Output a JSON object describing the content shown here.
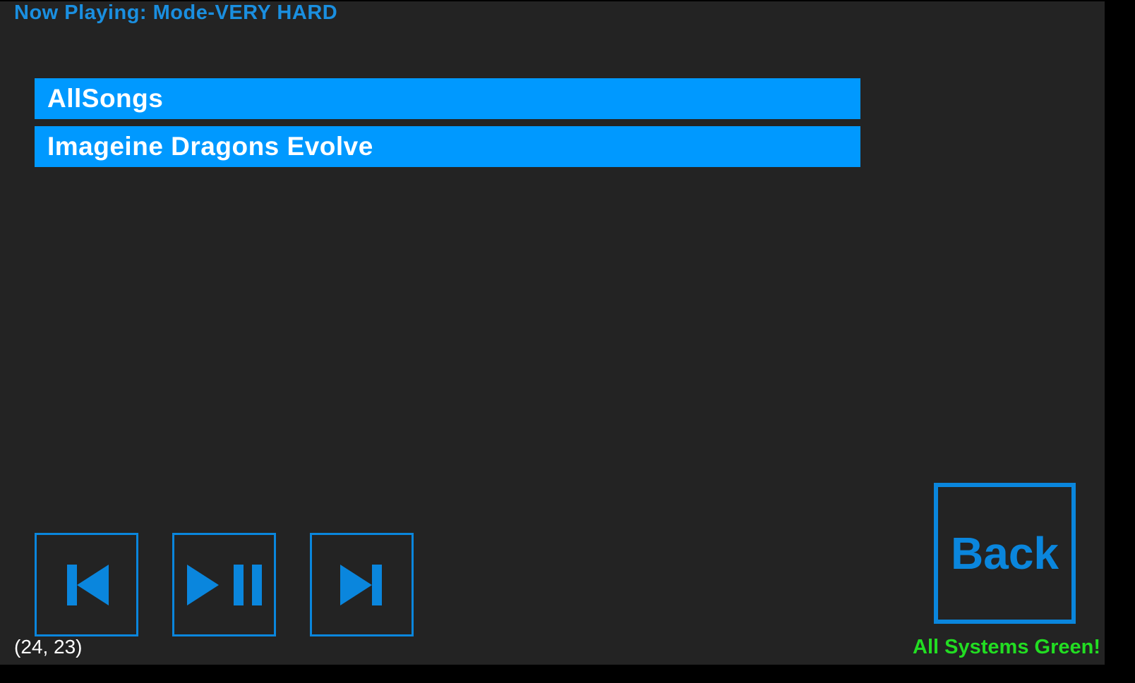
{
  "header": {
    "now_playing": "Now Playing: Mode-VERY HARD"
  },
  "playlist": {
    "items": [
      {
        "label": "AllSongs"
      },
      {
        "label": "Imageine Dragons Evolve"
      }
    ]
  },
  "controls": {
    "previous_icon": "skip-previous-icon",
    "play_pause_icon": "play-pause-icon",
    "next_icon": "skip-next-icon"
  },
  "back_button": {
    "label": "Back"
  },
  "footer": {
    "cursor_readout": "(24, 23)",
    "status": "All Systems Green!"
  },
  "colors": {
    "background": "#232323",
    "accent": "#0099ff",
    "icon_blue": "#0a86dd",
    "status_green": "#22dd22"
  }
}
